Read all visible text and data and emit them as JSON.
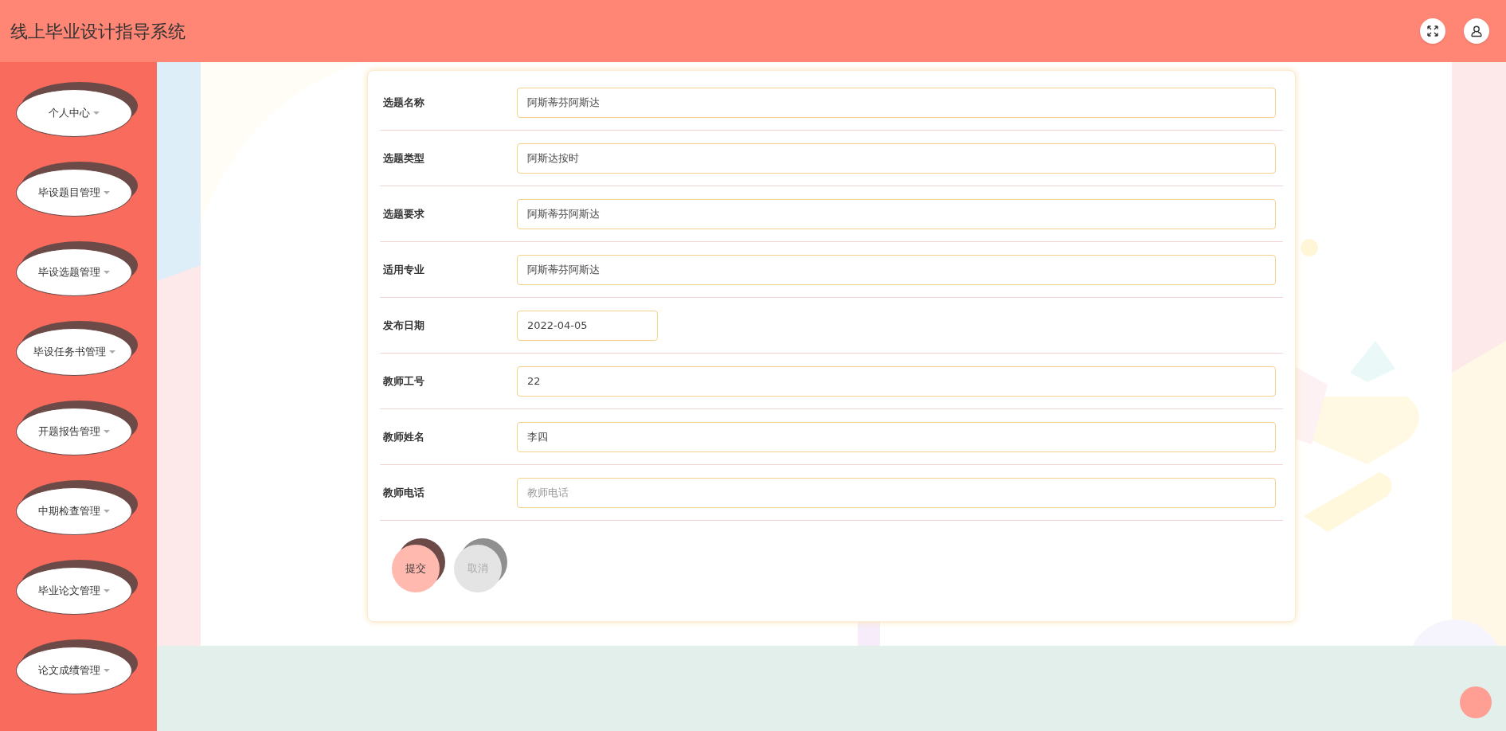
{
  "header": {
    "title": "线上毕业设计指导系统"
  },
  "sidebar": {
    "items": [
      {
        "label": "个人中心"
      },
      {
        "label": "毕设题目管理"
      },
      {
        "label": "毕设选题管理"
      },
      {
        "label": "毕设任务书管理"
      },
      {
        "label": "开题报告管理"
      },
      {
        "label": "中期检查管理"
      },
      {
        "label": "毕业论文管理"
      },
      {
        "label": "论文成绩管理"
      }
    ]
  },
  "form": {
    "fields": [
      {
        "label": "选题名称",
        "kind": "text",
        "value": "阿斯蒂芬阿斯达"
      },
      {
        "label": "选题类型",
        "kind": "text",
        "value": "阿斯达按时"
      },
      {
        "label": "选题要求",
        "kind": "text",
        "value": "阿斯蒂芬阿斯达"
      },
      {
        "label": "适用专业",
        "kind": "text",
        "value": "阿斯蒂芬阿斯达"
      },
      {
        "label": "发布日期",
        "kind": "date",
        "value": "2022-04-05"
      },
      {
        "label": "教师工号",
        "kind": "text",
        "value": "22"
      },
      {
        "label": "教师姓名",
        "kind": "text",
        "value": "李四"
      },
      {
        "label": "教师电话",
        "kind": "text",
        "placeholder": "教师电话"
      }
    ],
    "buttons": [
      {
        "label": "提交",
        "kind": "primary"
      },
      {
        "label": "取消",
        "kind": "cancel"
      }
    ]
  }
}
